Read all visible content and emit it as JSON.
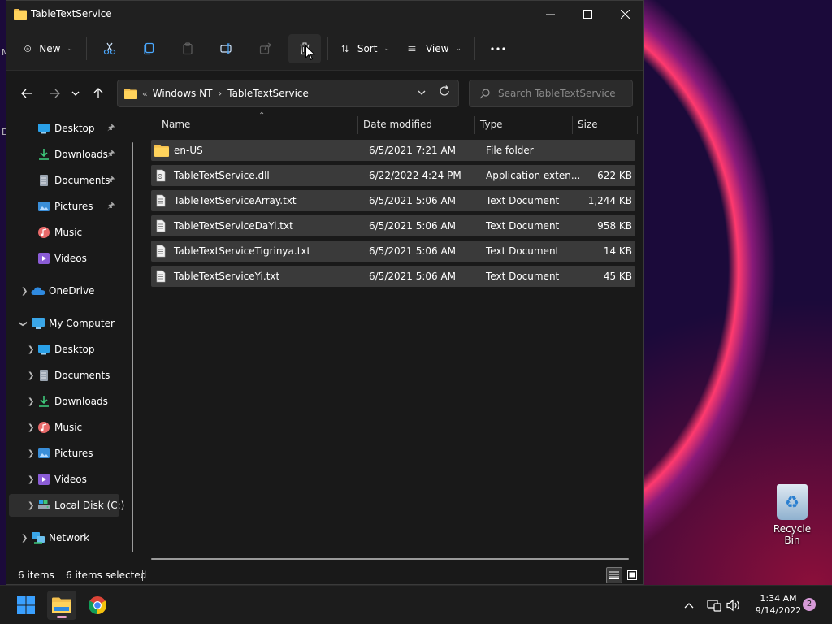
{
  "window": {
    "title": "TableTextService"
  },
  "commandbar": {
    "new_label": "New",
    "sort_label": "Sort",
    "view_label": "View"
  },
  "address": {
    "crumb_lead": "«",
    "crumbs": [
      "Windows NT",
      "TableTextService"
    ]
  },
  "search": {
    "placeholder": "Search TableTextService"
  },
  "sidebar": {
    "quick": [
      {
        "label": "Desktop"
      },
      {
        "label": "Downloads"
      },
      {
        "label": "Documents"
      },
      {
        "label": "Pictures"
      },
      {
        "label": "Music"
      },
      {
        "label": "Videos"
      }
    ],
    "onedrive": "OneDrive",
    "mycomputer": "My Computer",
    "computer_items": [
      {
        "label": "Desktop"
      },
      {
        "label": "Documents"
      },
      {
        "label": "Downloads"
      },
      {
        "label": "Music"
      },
      {
        "label": "Pictures"
      },
      {
        "label": "Videos"
      },
      {
        "label": "Local Disk (C:)"
      }
    ],
    "network": "Network"
  },
  "columns": {
    "name": "Name",
    "date": "Date modified",
    "type": "Type",
    "size": "Size"
  },
  "files": [
    {
      "name": "en-US",
      "date": "6/5/2021 7:21 AM",
      "type": "File folder",
      "size": "",
      "kind": "folder"
    },
    {
      "name": "TableTextService.dll",
      "date": "6/22/2022 4:24 PM",
      "type": "Application exten...",
      "size": "622 KB",
      "kind": "dll"
    },
    {
      "name": "TableTextServiceArray.txt",
      "date": "6/5/2021 5:06 AM",
      "type": "Text Document",
      "size": "1,244 KB",
      "kind": "txt"
    },
    {
      "name": "TableTextServiceDaYi.txt",
      "date": "6/5/2021 5:06 AM",
      "type": "Text Document",
      "size": "958 KB",
      "kind": "txt"
    },
    {
      "name": "TableTextServiceTigrinya.txt",
      "date": "6/5/2021 5:06 AM",
      "type": "Text Document",
      "size": "14 KB",
      "kind": "txt"
    },
    {
      "name": "TableTextServiceYi.txt",
      "date": "6/5/2021 5:06 AM",
      "type": "Text Document",
      "size": "45 KB",
      "kind": "txt"
    }
  ],
  "status": {
    "count": "6 items",
    "selected": "6 items selected"
  },
  "desktop": {
    "recycle_bin": "Recycle Bin",
    "stray_m": "M",
    "stray_d": "D"
  },
  "taskbar": {
    "time": "1:34 AM",
    "date": "9/14/2022",
    "notifications": "2"
  },
  "colors": {
    "folder": "#f4c04e",
    "accent_blue": "#1e90ff",
    "window_bg": "#191919",
    "row_selected": "#3a3a3a"
  }
}
